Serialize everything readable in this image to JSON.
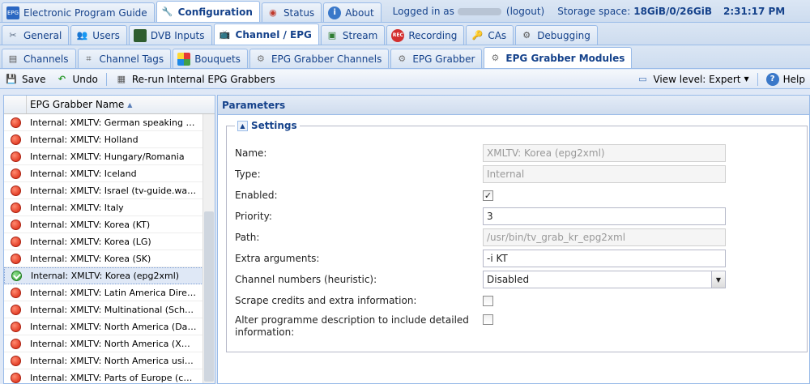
{
  "top_tabs": [
    {
      "label": "Electronic Program Guide",
      "icon": "epg-icon"
    },
    {
      "label": "Configuration",
      "icon": "wrench-icon",
      "active": true
    },
    {
      "label": "Status",
      "icon": "eye-icon"
    },
    {
      "label": "About",
      "icon": "info-icon"
    }
  ],
  "top_status": {
    "logged_in_prefix": "Logged in as",
    "logout_label": "(logout)",
    "storage_prefix": "Storage space:",
    "storage_value": "18GiB/0/26GiB",
    "clock": "2:31:17 PM"
  },
  "config_tabs": [
    {
      "label": "General",
      "icon": "tools-icon"
    },
    {
      "label": "Users",
      "icon": "users-icon"
    },
    {
      "label": "DVB Inputs",
      "icon": "card-icon"
    },
    {
      "label": "Channel / EPG",
      "icon": "tv-icon",
      "active": true
    },
    {
      "label": "Stream",
      "icon": "stream-icon"
    },
    {
      "label": "Recording",
      "icon": "rec-icon"
    },
    {
      "label": "CAs",
      "icon": "key-icon"
    },
    {
      "label": "Debugging",
      "icon": "bug-icon"
    }
  ],
  "epg_tabs": [
    {
      "label": "Channels",
      "icon": "channels-icon"
    },
    {
      "label": "Channel Tags",
      "icon": "tags-icon"
    },
    {
      "label": "Bouquets",
      "icon": "bouquets-icon"
    },
    {
      "label": "EPG Grabber Channels",
      "icon": "grabber-channels-icon"
    },
    {
      "label": "EPG Grabber",
      "icon": "grabber-icon"
    },
    {
      "label": "EPG Grabber Modules",
      "icon": "grabber-modules-icon",
      "active": true
    }
  ],
  "toolbar": {
    "save_label": "Save",
    "undo_label": "Undo",
    "rerun_label": "Re-run Internal EPG Grabbers",
    "view_level_label": "View level: Expert",
    "help_label": "Help"
  },
  "grid": {
    "column_header": "EPG Grabber Name",
    "rows": [
      {
        "name": "Internal: XMLTV: German speaking area (Tvbrowser.org)",
        "enabled": false
      },
      {
        "name": "Internal: XMLTV: Holland",
        "enabled": false
      },
      {
        "name": "Internal: XMLTV: Hungary/Romania",
        "enabled": false
      },
      {
        "name": "Internal: XMLTV: Iceland",
        "enabled": false
      },
      {
        "name": "Internal: XMLTV: Israel (tv-guide.walla.co.il)",
        "enabled": false
      },
      {
        "name": "Internal: XMLTV: Italy",
        "enabled": false
      },
      {
        "name": "Internal: XMLTV: Korea (KT)",
        "enabled": false
      },
      {
        "name": "Internal: XMLTV: Korea (LG)",
        "enabled": false
      },
      {
        "name": "Internal: XMLTV: Korea (SK)",
        "enabled": false
      },
      {
        "name": "Internal: XMLTV: Korea (epg2xml)",
        "enabled": true,
        "selected": true
      },
      {
        "name": "Internal: XMLTV: Latin America Direct TV",
        "enabled": false
      },
      {
        "name": "Internal: XMLTV: Multinational (Schedules Direct)",
        "enabled": false
      },
      {
        "name": "Internal: XMLTV: North America (Data Direct)",
        "enabled": false
      },
      {
        "name": "Internal: XMLTV: North America (XMLTV)",
        "enabled": false
      },
      {
        "name": "Internal: XMLTV: North America using www",
        "enabled": false
      },
      {
        "name": "Internal: XMLTV: Parts of Europe (commercial)",
        "enabled": false
      }
    ]
  },
  "parameters": {
    "title": "Parameters",
    "settings_legend": "Settings",
    "fields": {
      "name": {
        "label": "Name:",
        "value": "XMLTV: Korea (epg2xml)"
      },
      "type": {
        "label": "Type:",
        "value": "Internal"
      },
      "enabled": {
        "label": "Enabled:",
        "checked": true
      },
      "priority": {
        "label": "Priority:",
        "value": "3"
      },
      "path": {
        "label": "Path:",
        "value": "/usr/bin/tv_grab_kr_epg2xml"
      },
      "extra_args": {
        "label": "Extra arguments:",
        "value": "-i KT"
      },
      "channel_numbers": {
        "label": "Channel numbers (heuristic):",
        "value": "Disabled"
      },
      "scrape_credits": {
        "label": "Scrape credits and extra information:",
        "checked": false
      },
      "alter_description": {
        "label": "Alter programme description to include detailed information:",
        "checked": false
      }
    }
  },
  "colors": {
    "accent": "#15428b",
    "border": "#99bbe8",
    "enabled": "#2e9b2e",
    "disabled": "#d8200a"
  }
}
